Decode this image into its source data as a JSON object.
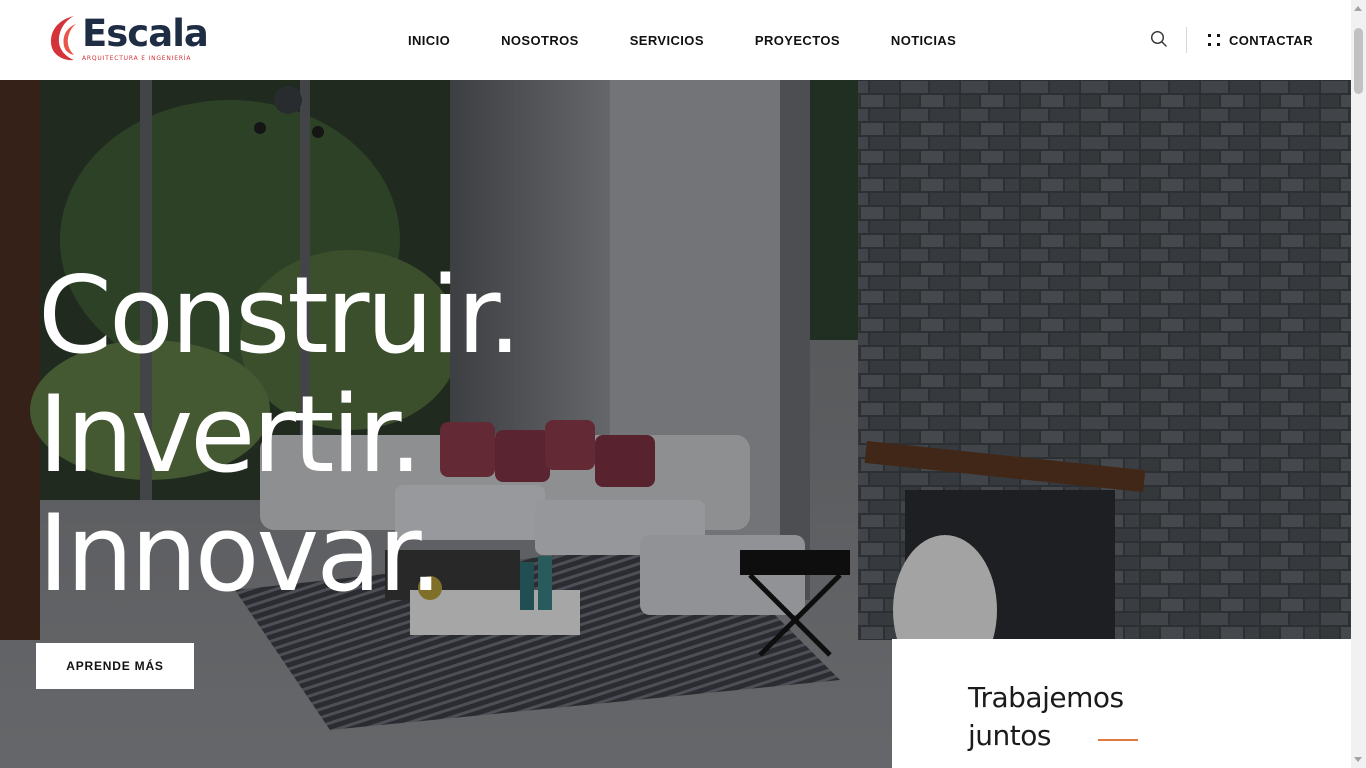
{
  "brand": {
    "name": "Escala",
    "tagline": "ARQUITECTURA E INGENIERÍA",
    "colors": {
      "navy": "#1f2d44",
      "red": "#d2343a",
      "accent": "#e07a3f"
    }
  },
  "nav": {
    "items": [
      {
        "label": "INICIO"
      },
      {
        "label": "NOSOTROS"
      },
      {
        "label": "SERVICIOS"
      },
      {
        "label": "PROYECTOS"
      },
      {
        "label": "NOTICIAS"
      }
    ],
    "search_icon": "search-icon",
    "contact_label": "CONTACTAR",
    "contact_icon": "grid-dots-icon"
  },
  "hero": {
    "lines": [
      "Construir.",
      "Invertir.",
      "Innovar."
    ],
    "cta_label": "APRENDE MÁS"
  },
  "card": {
    "title_line1": "Trabajemos",
    "title_line2": "juntos"
  }
}
